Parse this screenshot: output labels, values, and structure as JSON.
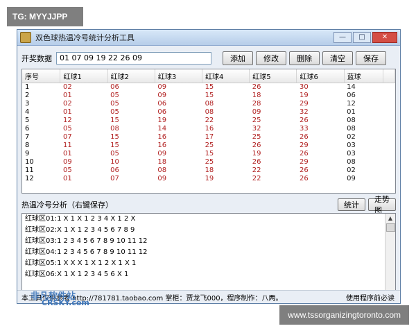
{
  "overlay": {
    "tg_label": "TG: MYYJJPP",
    "site_label": "www.tssorganizingtoronto.com",
    "watermark_logo": "非凡软件站",
    "watermark_sub": "CRSKY.com"
  },
  "window": {
    "title": "双色球热温冷号统计分析工具",
    "winbtn_min": "—",
    "winbtn_max": "□",
    "winbtn_close": "✕"
  },
  "toolbar": {
    "label": "开奖数据",
    "input_value": "01 07 09 19 22 26 09",
    "buttons": [
      "添加",
      "修改",
      "删除",
      "清空",
      "保存"
    ]
  },
  "table": {
    "headers": [
      "序号",
      "红球1",
      "红球2",
      "红球3",
      "红球4",
      "红球5",
      "红球6",
      "蓝球"
    ],
    "rows": [
      [
        "1",
        "02",
        "06",
        "09",
        "15",
        "26",
        "30",
        "14"
      ],
      [
        "2",
        "01",
        "05",
        "09",
        "15",
        "18",
        "19",
        "06"
      ],
      [
        "3",
        "02",
        "05",
        "06",
        "08",
        "28",
        "29",
        "12"
      ],
      [
        "4",
        "01",
        "05",
        "06",
        "08",
        "09",
        "32",
        "01"
      ],
      [
        "5",
        "12",
        "15",
        "19",
        "22",
        "25",
        "26",
        "08"
      ],
      [
        "6",
        "05",
        "08",
        "14",
        "16",
        "32",
        "33",
        "08"
      ],
      [
        "7",
        "07",
        "15",
        "16",
        "17",
        "25",
        "26",
        "02"
      ],
      [
        "8",
        "11",
        "15",
        "16",
        "25",
        "26",
        "29",
        "03"
      ],
      [
        "9",
        "01",
        "05",
        "09",
        "15",
        "19",
        "26",
        "03"
      ],
      [
        "10",
        "09",
        "10",
        "18",
        "25",
        "26",
        "29",
        "08"
      ],
      [
        "11",
        "05",
        "06",
        "08",
        "18",
        "22",
        "26",
        "02"
      ],
      [
        "12",
        "01",
        "07",
        "09",
        "19",
        "22",
        "26",
        "09"
      ]
    ]
  },
  "analysis": {
    "label": "热温冷号分析（右键保存）",
    "btn_stats": "统计",
    "btn_trend": "走势图",
    "lines": [
      "红球区01:1 X 1 X 1 2 3 4 X 1 2 X",
      "红球区02:X 1 X 1 2 3 4 5 6 7 8 9",
      "红球区03:1 2 3 4 5 6 7 8 9 10 11 12",
      "红球区04:1 2 3 4 5 6 7 8 9 10 11 12",
      "红球区05:1 X X X 1 X 1 2 X 1 X 1",
      "红球区06:X 1 X 1 2 3 4 5 6 X 1"
    ]
  },
  "status": {
    "left": "本工具仅供参考 http://781781.taobao.com 掌柜：贾龙飞000，程序制作：八两。",
    "right": "使用程序前必读"
  }
}
